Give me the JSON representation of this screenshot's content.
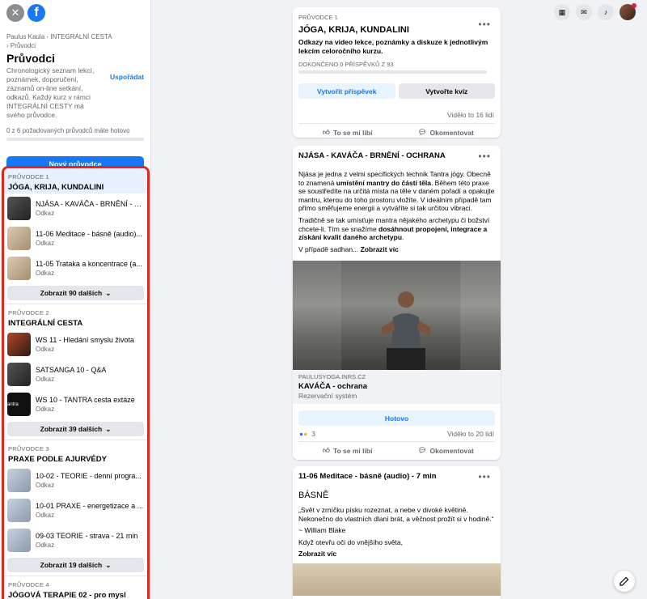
{
  "sidebar": {
    "breadcrumb_group": "Paulus Kaula - INTEGRÁLNÍ CESTA",
    "breadcrumb_current": "› Průvodci",
    "title": "Průvodci",
    "description": "Chronologický seznam lekcí, poznámek, doporučení, záznamů on-line setkání, odkazů. Každý kurz v rámci INTEGRÁLNÍ CESTY má svého průvodce.",
    "arrange_label": "Uspořádat",
    "progress_text": "0 z 6 požadovaných průvodců máte hotovo",
    "progress_fraction": 0,
    "new_guide_label": "Nový průvodce"
  },
  "guides": [
    {
      "label": "PRŮVODCE 1",
      "title": "JÓGA, KRIJA, KUNDALINI",
      "items": [
        {
          "title": "NJÁSA - KAVÁČA - BRNĚNÍ - O...",
          "sub": "Odkaz"
        },
        {
          "title": "11-06 Meditace - básně (audio)...",
          "sub": "Odkaz"
        },
        {
          "title": "11-05 Trataka a koncentrace (a...",
          "sub": "Odkaz"
        }
      ],
      "more": "Zobrazit 90 dalších"
    },
    {
      "label": "PRŮVODCE 2",
      "title": "INTEGRÁLNÍ CESTA",
      "items": [
        {
          "title": "WS 11 - Hledání smyslu života",
          "sub": "Odkaz"
        },
        {
          "title": "SATSANGA 10 - Q&A",
          "sub": "Odkaz"
        },
        {
          "title": "WS 10 - TANTRA cesta extáze",
          "sub": "Odkaz",
          "thumb_text": "antra"
        }
      ],
      "more": "Zobrazit 39 dalších"
    },
    {
      "label": "PRŮVODCE 3",
      "title": "PRAXE PODLE AJURVÉDY",
      "items": [
        {
          "title": "10-02 - TEORIE - denní progra...",
          "sub": "Odkaz"
        },
        {
          "title": "10-01 PRAXE - energetizace a ...",
          "sub": "Odkaz"
        },
        {
          "title": "09-03 TEORIE - strava - 21 min",
          "sub": "Odkaz"
        }
      ],
      "more": "Zobrazit 19 dalších"
    },
    {
      "label": "PRŮVODCE 4",
      "title": "JÓGOVÁ TERAPIE 02 - pro mysl"
    }
  ],
  "card1": {
    "label": "PRŮVODCE 1",
    "title": "JÓGA, KRIJA, KUNDALINI",
    "description": "Odkazy na video lekce, poznámky a diskuze k jednotlivým lekcím celoročního kurzu.",
    "done_text": "DOKONČENO 0 PŘÍSPĚVKŮ Z 93",
    "create_post": "Vytvořit příspěvek",
    "create_quiz": "Vytvořte kvíz",
    "seen": "Viděło to 16 lidí",
    "like": "To se mi líbí",
    "comment": "Okomentovat"
  },
  "card2": {
    "title": "NJÁSA - KAVÁČA - BRNĚNÍ - OCHRANA",
    "p1_a": "Njása je jedna z velmi specifických technik Tantra jógy. Obecně to znamená ",
    "p1_b": "umístění mantry do částí těla",
    "p1_c": ". Během této praxe se soustředíte na určitá místa na těle v daném pořadí a opakujte mantru, kterou do toho prostoru vložíte. V ideálním případě tam přímo směřujeme energii a vytváříte si tak určitou vibraci.",
    "p2_a": "Tradičně se tak umísťuje mantra nějakého archetypu či božství chcete-li. Tím se snažíme ",
    "p2_b": "dosáhnout propojení, integrace a získání kvalit daného archetypu",
    "p2_c": ".",
    "p3_a": "V případě sadhan... ",
    "p3_more": "Zobrazit víc",
    "link_domain": "PAULUSYOGA.INRS.CZ",
    "link_title": "KAVÁČA - ochrana",
    "link_sub": "Rezervační systém",
    "done_label": "Hotovo",
    "reactions": "3",
    "seen": "Viděło to 20 lidí",
    "like": "To se mi líbí",
    "comment": "Okomentovat"
  },
  "card3": {
    "title": "11-06 Meditace - básně (audio) - 7 min",
    "heading": "BÁSNĚ",
    "quote": "„Svět v zrníčku písku rozeznat, a nebe v divoké květině. Nekonečno do vlastních dlaní brát, a věčnost prožít si v hodině.“",
    "author": "~ William Blake",
    "line": "Když otevřu oči do vnějšího světa,",
    "more": "Zobrazit víc"
  },
  "colors": {
    "accent": "#1877f2",
    "highlight_border": "#e2261c"
  }
}
